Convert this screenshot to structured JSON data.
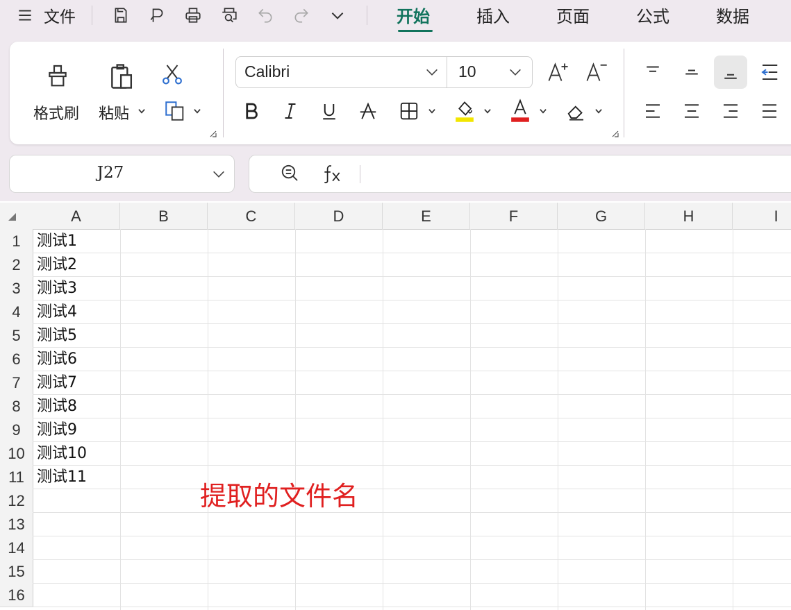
{
  "menu": {
    "file_label": "文件",
    "tabs": [
      "开始",
      "插入",
      "页面",
      "公式",
      "数据"
    ],
    "active_tab_index": 0
  },
  "ribbon": {
    "format_painter_label": "格式刷",
    "paste_label": "粘贴",
    "font_name": "Calibri",
    "font_size": "10",
    "highlight_color": "#f2e600",
    "font_color": "#e02020"
  },
  "formula_bar": {
    "name_box": "J27",
    "formula": ""
  },
  "sheet": {
    "columns": [
      "A",
      "B",
      "C",
      "D",
      "E",
      "F",
      "G",
      "H",
      "I"
    ],
    "rows": [
      "1",
      "2",
      "3",
      "4",
      "5",
      "6",
      "7",
      "8",
      "9",
      "10",
      "11",
      "12",
      "13",
      "14",
      "15",
      "16"
    ],
    "column_a_values": [
      "测试1",
      "测试2",
      "测试3",
      "测试4",
      "测试5",
      "测试6",
      "测试7",
      "测试8",
      "测试9",
      "测试10",
      "测试11"
    ]
  },
  "annotation": {
    "text": "提取的文件名",
    "color": "#e02020"
  }
}
